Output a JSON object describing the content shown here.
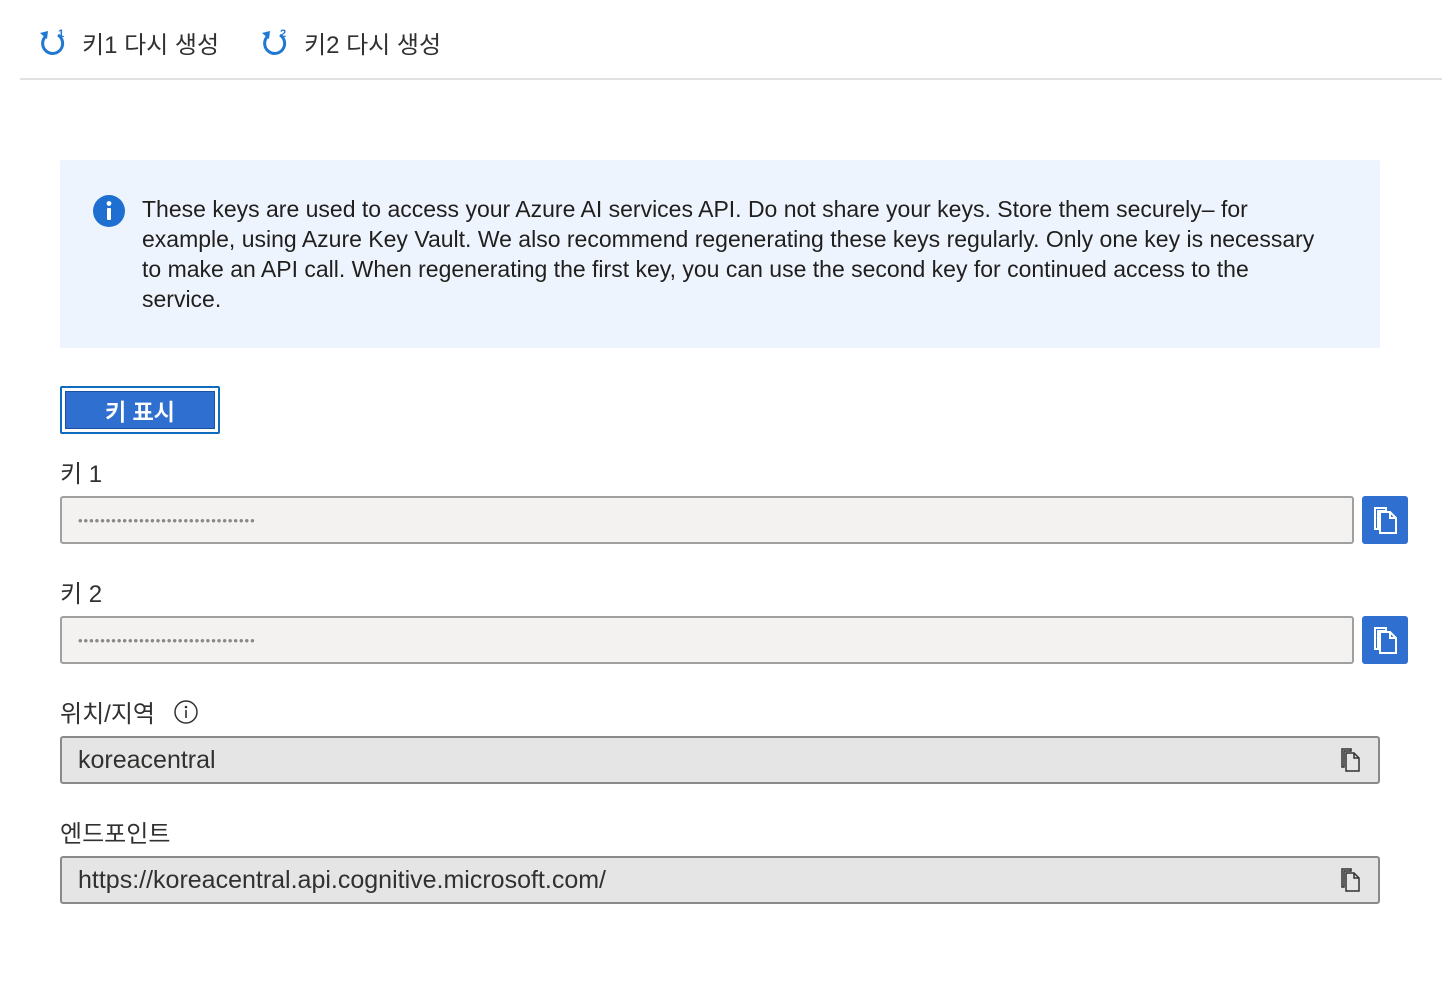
{
  "toolbar": {
    "regen_key1_label": "키1 다시 생성",
    "regen_key2_label": "키2 다시 생성",
    "regen_key1_badge": "1",
    "regen_key2_badge": "2"
  },
  "info": {
    "text": "These keys are used to access your Azure AI services API. Do not share your keys. Store them securely– for example, using Azure Key Vault. We also recommend regenerating these keys regularly. Only one key is necessary to make an API call. When regenerating the first key, you can use the second key for continued access to the service."
  },
  "show_keys_label": "키 표시",
  "fields": {
    "key1": {
      "label": "키 1",
      "value": "••••••••••••••••••••••••••••••••"
    },
    "key2": {
      "label": "키 2",
      "value": "••••••••••••••••••••••••••••••••"
    },
    "location": {
      "label": "위치/지역",
      "value": "koreacentral"
    },
    "endpoint": {
      "label": "엔드포인트",
      "value": "https://koreacentral.api.cognitive.microsoft.com/"
    }
  },
  "icons": {
    "regenerate": "refresh-icon",
    "info": "info-icon",
    "help": "help-icon",
    "copy": "copy-icon"
  },
  "colors": {
    "accent": "#2f6fcf",
    "info_bg": "#eef4fd",
    "refresh_icon": "#1f78d1"
  }
}
